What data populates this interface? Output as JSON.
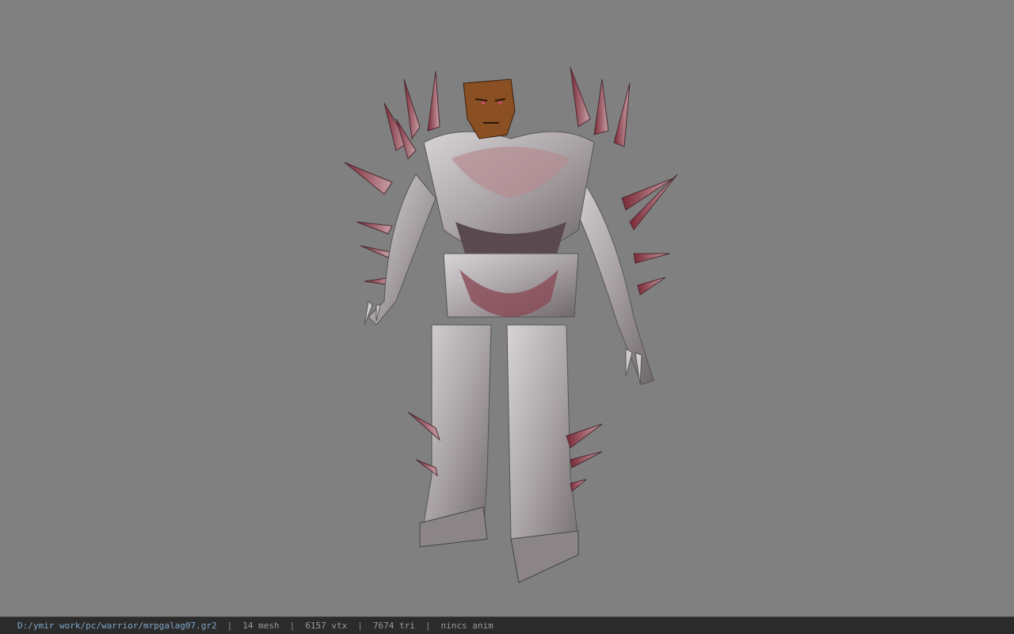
{
  "viewer": {
    "background_color": "#808080",
    "model_icon": "armored-warrior-model"
  },
  "status_bar": {
    "file_path": "D:/ymir work/pc/warrior/mrpgalag07.gr2",
    "separator": "|",
    "mesh_count": "14 mesh",
    "vertex_count": "6157 vtx",
    "triangle_count": "7674 tri",
    "animation_status": "nincs anim"
  }
}
